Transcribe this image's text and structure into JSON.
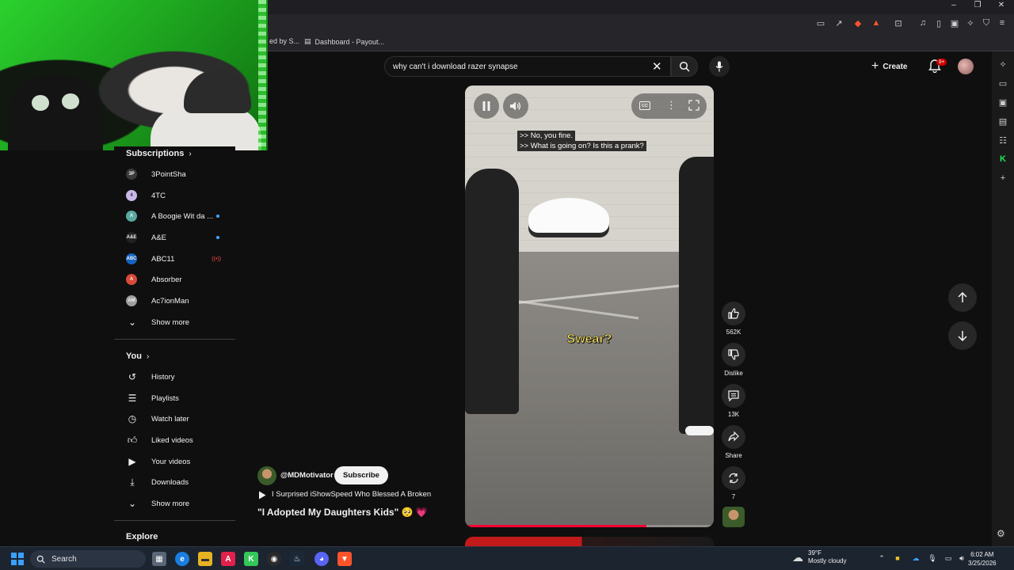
{
  "browser": {
    "bookmarks": [
      {
        "label": "ed by S..."
      },
      {
        "label": "Dashboard - Payout..."
      }
    ],
    "shield_badge": "1",
    "notif_badge": "9+"
  },
  "masthead": {
    "search_value": "why can't i download razer synapse",
    "create_label": "Create",
    "notifications_badge": "9+"
  },
  "sidebar": {
    "subscriptions_title": "Subscriptions",
    "subscriptions": [
      {
        "name": "3PointSha",
        "avatar_color": "#3a3a3a",
        "avatar_text": "3P",
        "status": ""
      },
      {
        "name": "4TC",
        "avatar_color": "#c9b7e8",
        "avatar_text": "4",
        "status": ""
      },
      {
        "name": "A Boogie Wit da ...",
        "avatar_color": "#5aa8a0",
        "avatar_text": "A",
        "status": "new"
      },
      {
        "name": "A&E",
        "avatar_color": "#222222",
        "avatar_text": "A&E",
        "status": "new"
      },
      {
        "name": "ABC11",
        "avatar_color": "#1565c0",
        "avatar_text": "ABC",
        "status": "live"
      },
      {
        "name": "Absorber",
        "avatar_color": "#d84a3a",
        "avatar_text": "A",
        "status": ""
      },
      {
        "name": "Ac7ionMan",
        "avatar_color": "#9e9e9e",
        "avatar_text": "AM",
        "status": ""
      }
    ],
    "subscriptions_show_more": "Show more",
    "you_title": "You",
    "you_items": [
      {
        "label": "History",
        "icon": "history-icon"
      },
      {
        "label": "Playlists",
        "icon": "playlists-icon"
      },
      {
        "label": "Watch later",
        "icon": "watch-later-icon"
      },
      {
        "label": "Liked videos",
        "icon": "liked-videos-icon"
      },
      {
        "label": "Your videos",
        "icon": "your-videos-icon"
      },
      {
        "label": "Downloads",
        "icon": "downloads-icon"
      }
    ],
    "you_show_more": "Show more",
    "explore_title": "Explore"
  },
  "player": {
    "captions": [
      ">> No, you fine.",
      ">> What is going on? Is this a prank?"
    ],
    "burned_caption": "Swear?",
    "cc_label": "CC",
    "progress": 0.73
  },
  "actions": {
    "likes": "562K",
    "dislike_label": "Dislike",
    "comments": "13K",
    "share_label": "Share",
    "remix_count": "7"
  },
  "meta": {
    "channel_handle": "@MDMotivator",
    "subscribe_label": "Subscribe",
    "subtitle": "I Surprised iShowSpeed Who Blessed A Broken",
    "title": "\"I Adopted My Daughters Kids\" 🥺 💗"
  },
  "taskbar": {
    "search_label": "Search",
    "weather_temp": "39°F",
    "weather_desc": "Mostly cloudy",
    "weather_badge": "1",
    "time": "6:02 AM",
    "date": "3/25/2026"
  },
  "colors": {
    "background": "#0f0f0f",
    "accent_red": "#ff0033",
    "caption_yellow": "#f7e35a",
    "chip_bg": "#272727"
  }
}
